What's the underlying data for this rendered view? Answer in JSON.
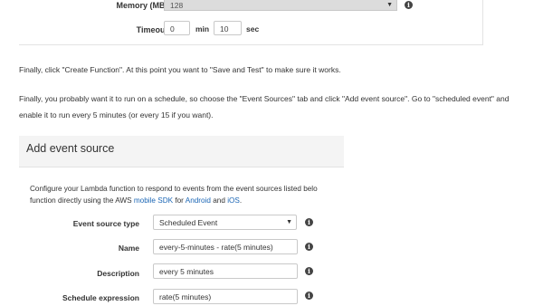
{
  "top_form": {
    "memory_label": "Memory (MB)*",
    "memory_value": "128",
    "timeout_label": "Timeout*",
    "timeout_min_value": "0",
    "timeout_min_unit": "min",
    "timeout_sec_value": "10",
    "timeout_sec_unit": "sec"
  },
  "paragraphs": {
    "p1": "Finally, click \"Create Function\". At this point you want to \"Save and Test\" to make sure it works.",
    "p2_line1": "Finally, you probably want it to run on a schedule, so choose the \"Event Sources\" tab and click \"Add event source\". Go to \"scheduled event\" and",
    "p2_line2": "enable it to run every 5 minutes (or every 15 if you want)."
  },
  "dialog": {
    "title": "Add event source",
    "desc_line1": "Configure your Lambda function to respond to events from the event sources listed belo",
    "desc_line2_prefix": "function directly using the AWS ",
    "desc_link_sdk": "mobile SDK",
    "desc_for": " for ",
    "desc_link_android": "Android",
    "desc_and": " and ",
    "desc_link_ios": "iOS",
    "desc_end": ".",
    "fields": {
      "event_source_type_label": "Event source type",
      "event_source_type_value": "Scheduled Event",
      "name_label": "Name",
      "name_value": "every-5-minutes - rate(5 minutes)",
      "description_label": "Description",
      "description_value": "every 5 minutes",
      "schedule_label": "Schedule expression",
      "schedule_value": "rate(5 minutes)"
    }
  },
  "icons": {
    "info": "info-icon",
    "caret": "caret-down-icon"
  }
}
